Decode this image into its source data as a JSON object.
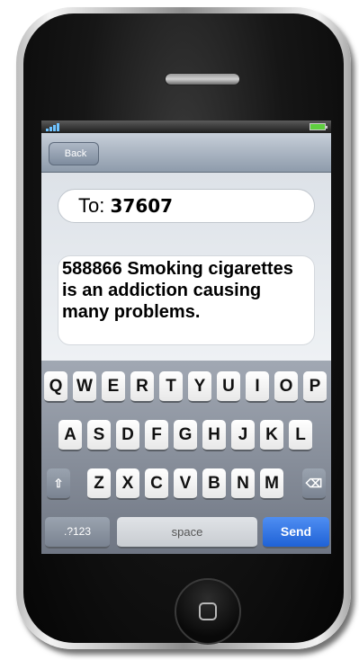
{
  "nav": {
    "back_label": "Back"
  },
  "recipient": {
    "label": "To:",
    "number": "37607"
  },
  "message": {
    "code": "588866",
    "text": "Smoking cigarettes is an addiction causing many problems."
  },
  "keyboard": {
    "row1": [
      "Q",
      "W",
      "E",
      "R",
      "T",
      "Y",
      "U",
      "I",
      "O",
      "P"
    ],
    "row2": [
      "A",
      "S",
      "D",
      "F",
      "G",
      "H",
      "J",
      "K",
      "L"
    ],
    "row3": [
      "Z",
      "X",
      "C",
      "V",
      "B",
      "N",
      "M"
    ],
    "shift_icon": "⇧",
    "delete_icon": "⌫",
    "numbers_label": ".?123",
    "space_label": "space",
    "send_label": "Send"
  },
  "colors": {
    "send": "#1f62d6",
    "navbar": "#8e9bab"
  }
}
